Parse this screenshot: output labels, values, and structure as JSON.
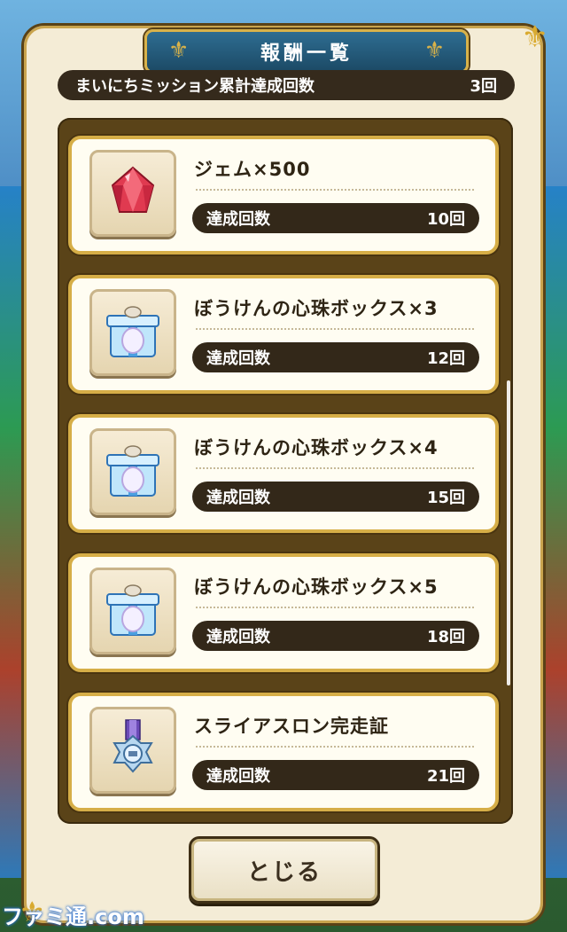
{
  "dialog": {
    "title": "報酬一覧",
    "summary_label": "まいにちミッション累計達成回数",
    "summary_value": "3回"
  },
  "rewards": [
    {
      "name": "ジェム×500",
      "progress_label": "達成回数",
      "progress_value": "10回",
      "icon": "gem-icon"
    },
    {
      "name": "ぼうけんの心珠ボックス×3",
      "progress_label": "達成回数",
      "progress_value": "12回",
      "icon": "gift-box-icon"
    },
    {
      "name": "ぼうけんの心珠ボックス×4",
      "progress_label": "達成回数",
      "progress_value": "15回",
      "icon": "gift-box-icon"
    },
    {
      "name": "ぼうけんの心珠ボックス×5",
      "progress_label": "達成回数",
      "progress_value": "18回",
      "icon": "gift-box-icon"
    },
    {
      "name": "スライアスロン完走証",
      "progress_label": "達成回数",
      "progress_value": "21回",
      "icon": "medal-icon"
    }
  ],
  "close_button": {
    "label": "とじる"
  },
  "watermark": "ファミ通.com",
  "colors": {
    "accent_gold": "#d6ae47",
    "title_blue": "#1c4a66",
    "dark_pill": "#332819"
  }
}
